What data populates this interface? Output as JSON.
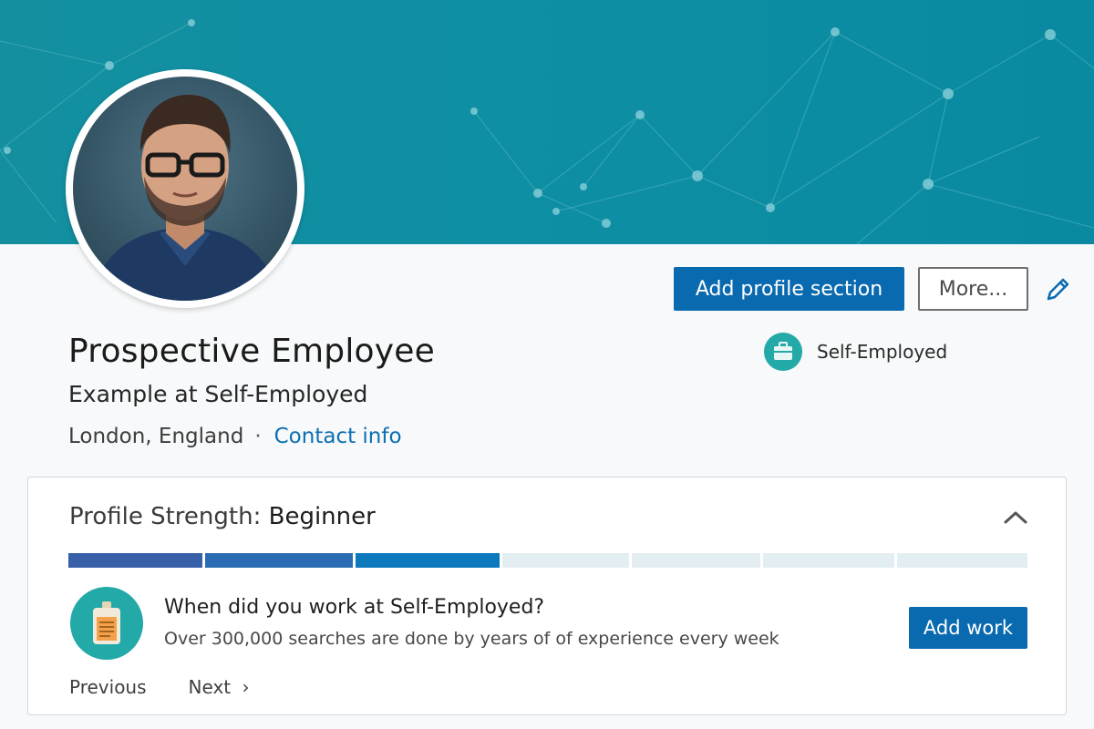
{
  "profile": {
    "name": "Prospective Employee",
    "headline": "Example at Self-Employed",
    "location": "London, England",
    "separator": "·",
    "contact_link": "Contact info",
    "current_company": "Self-Employed"
  },
  "actions": {
    "add_section_label": "Add profile section",
    "more_label": "More...",
    "edit_icon": "pencil-icon"
  },
  "strength": {
    "label": "Profile Strength: ",
    "level": "Beginner",
    "progress_filled_segments": 3,
    "progress_total_segments": 7,
    "suggestion_title": "When did you work at Self-Employed?",
    "suggestion_body": "Over 300,000 searches are done by years of of experience every week",
    "add_work_label": "Add work",
    "previous_label": "Previous",
    "next_label": "Next"
  },
  "colors": {
    "banner": "#0f8fa3",
    "primary_button": "#0a6aaf",
    "link": "#0b6fb3",
    "icon_teal": "#23a9a8",
    "progress_filled": "#2a6cb3",
    "progress_empty": "#e3eef2"
  }
}
